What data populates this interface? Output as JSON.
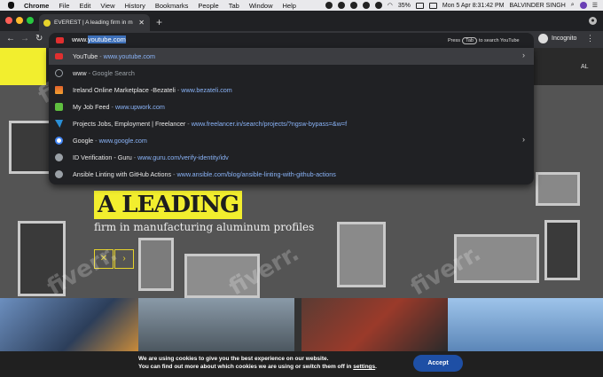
{
  "menubar": {
    "app": "Chrome",
    "items": [
      "File",
      "Edit",
      "View",
      "History",
      "Bookmarks",
      "People",
      "Tab",
      "Window",
      "Help"
    ],
    "battery": "35%",
    "datetime": "Mon 5 Apr  8:31:42 PM",
    "user": "BALVINDER SINGH"
  },
  "tab": {
    "title": "EVEREST | A leading firm in m"
  },
  "omnibox": {
    "typed": "www.",
    "suggestion_rest": "youtube.com",
    "hint_pre": "Press",
    "hint_key": "Tab",
    "hint_post": "to search YouTube"
  },
  "profile": {
    "label": "Incognito"
  },
  "suggestions": [
    {
      "title": "YouTube",
      "sep": " - ",
      "url": "www.youtube.com",
      "icon": "youtube-icon",
      "arrow": true
    },
    {
      "title": "www",
      "sep": " - ",
      "url": "Google Search",
      "icon": "search-icon",
      "arrow": false,
      "dim": true
    },
    {
      "title": "Ireland Online Marketplace -Bezateli",
      "sep": " - ",
      "url": "www.bezateli.com",
      "icon": "bezateli-icon",
      "arrow": false
    },
    {
      "title": "My Job Feed",
      "sep": " - ",
      "url": "www.upwork.com",
      "icon": "upwork-icon",
      "arrow": false
    },
    {
      "title": "Projects Jobs, Employment | Freelancer",
      "sep": " - ",
      "url": "www.freelancer.in/search/projects/?ngsw-bypass=&w=f",
      "icon": "freelancer-icon",
      "arrow": false
    },
    {
      "title": "Google",
      "sep": " - ",
      "url": "www.google.com",
      "icon": "google-icon",
      "arrow": true
    },
    {
      "title": "ID Verification - Guru",
      "sep": " - ",
      "url": "www.guru.com/verify-identity/idv",
      "icon": "globe-icon",
      "arrow": false
    },
    {
      "title": "Ansible Linting with GitHub Actions",
      "sep": " - ",
      "url": "www.ansible.com/blog/ansible-linting-with-github-actions",
      "icon": "globe-icon",
      "arrow": false
    }
  ],
  "page": {
    "nav_fragment": "AL",
    "headline": "A LEADING",
    "subheadline": "firm in manufacturing aluminum profiles",
    "prev": "✕",
    "next": "›"
  },
  "cookie": {
    "line1": "We are using cookies to give you the best experience on our website.",
    "line2_pre": "You can find out more about which cookies we are using or switch them off in ",
    "line2_link": "settings",
    "line2_post": ".",
    "accept": "Accept"
  },
  "watermark": "fiverr.",
  "colors": {
    "accent": "#f2ee2e",
    "accept": "#1e4fa5",
    "link": "#8ab4f8"
  }
}
